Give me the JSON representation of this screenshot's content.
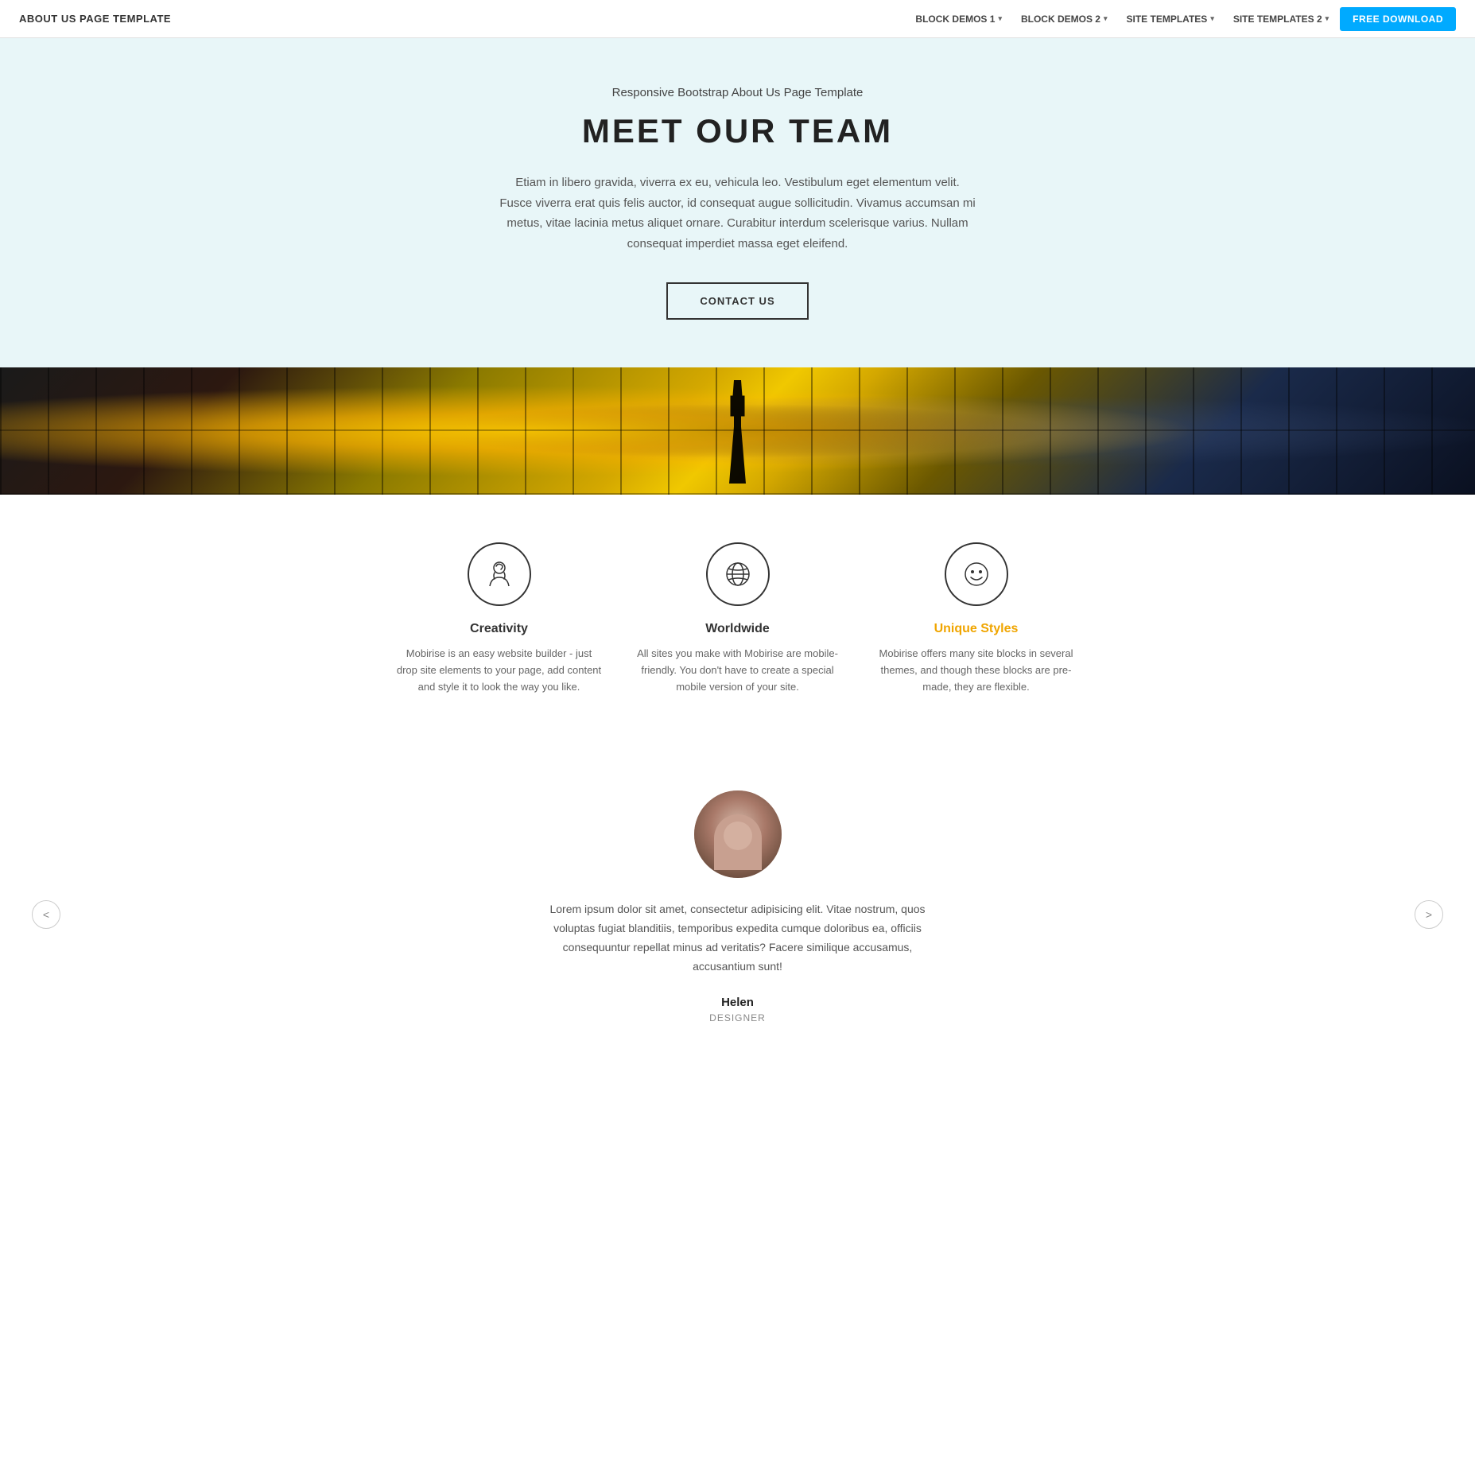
{
  "navbar": {
    "brand": "ABOUT US PAGE TEMPLATE",
    "links": [
      {
        "label": "BLOCK DEMOS 1",
        "has_dropdown": true
      },
      {
        "label": "BLOCK DEMOS 2",
        "has_dropdown": true
      },
      {
        "label": "SITE TEMPLATES",
        "has_dropdown": true
      },
      {
        "label": "SITE TEMPLATES 2",
        "has_dropdown": true
      }
    ],
    "cta_label": "FREE DOWNLOAD"
  },
  "hero": {
    "subtitle": "Responsive Bootstrap About Us Page Template",
    "title": "MEET OUR TEAM",
    "text": "Etiam in libero gravida, viverra ex eu, vehicula leo. Vestibulum eget elementum velit. Fusce viverra erat quis felis auctor, id consequat augue sollicitudin. Vivamus accumsan mi metus, vitae lacinia metus aliquet ornare. Curabitur interdum scelerisque varius. Nullam consequat imperdiet massa eget eleifend.",
    "button_label": "CONTACT US"
  },
  "features": {
    "items": [
      {
        "icon": "creativity",
        "title": "Creativity",
        "title_color": "normal",
        "desc": "Mobirise is an easy website builder - just drop site elements to your page, add content and style it to look the way you like."
      },
      {
        "icon": "worldwide",
        "title": "Worldwide",
        "title_color": "normal",
        "desc": "All sites you make with Mobirise are mobile-friendly. You don't have to create a special mobile version of your site."
      },
      {
        "icon": "unique",
        "title": "Unique Styles",
        "title_color": "unique",
        "desc": "Mobirise offers many site blocks in several themes, and though these blocks are pre-made, they are flexible."
      }
    ]
  },
  "testimonial": {
    "text": "Lorem ipsum dolor sit amet, consectetur adipisicing elit. Vitae nostrum, quos voluptas fugiat blanditiis, temporibus expedita cumque doloribus ea, officiis consequuntur repellat minus ad veritatis? Facere similique accusamus, accusantium sunt!",
    "name": "Helen",
    "role": "DESIGNER",
    "prev_label": "<",
    "next_label": ">"
  }
}
